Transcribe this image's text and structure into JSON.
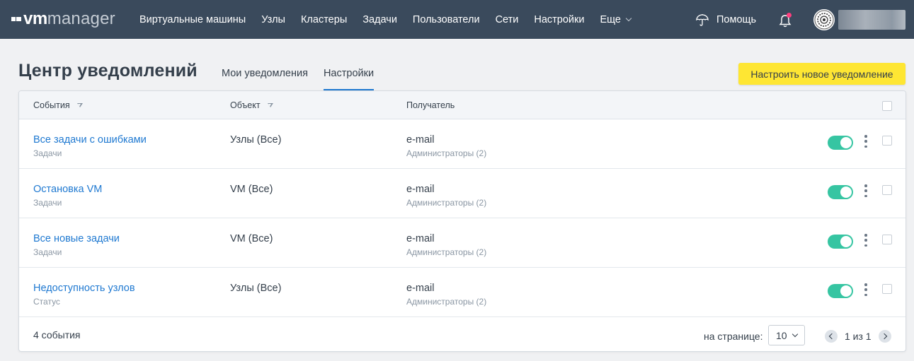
{
  "app": {
    "logo_vm": "vm",
    "logo_manager": "manager"
  },
  "nav": {
    "items": [
      {
        "label": "Виртуальные машины"
      },
      {
        "label": "Узлы"
      },
      {
        "label": "Кластеры"
      },
      {
        "label": "Задачи"
      },
      {
        "label": "Пользователи"
      },
      {
        "label": "Сети"
      },
      {
        "label": "Настройки"
      },
      {
        "label": "Еще"
      }
    ],
    "help_label": "Помощь",
    "notification_dot_color": "#ff3f7f"
  },
  "header": {
    "title": "Центр уведомлений",
    "tabs": [
      {
        "label": "Мои уведомления",
        "active": false
      },
      {
        "label": "Настройки",
        "active": true
      }
    ],
    "primary_button": "Настроить новое уведомление"
  },
  "table": {
    "columns": {
      "events": "События",
      "object": "Объект",
      "recipient": "Получатель"
    },
    "rows": [
      {
        "name": "Все задачи с ошибками",
        "category": "Задачи",
        "object": "Узлы (Все)",
        "recipient": "e-mail",
        "recipient_detail": "Администраторы (2)",
        "enabled": true
      },
      {
        "name": "Остановка VM",
        "category": "Задачи",
        "object": "VM (Все)",
        "recipient": "e-mail",
        "recipient_detail": "Администраторы (2)",
        "enabled": true
      },
      {
        "name": "Все новые задачи",
        "category": "Задачи",
        "object": "VM (Все)",
        "recipient": "e-mail",
        "recipient_detail": "Администраторы (2)",
        "enabled": true
      },
      {
        "name": "Недоступность узлов",
        "category": "Статус",
        "object": "Узлы (Все)",
        "recipient": "e-mail",
        "recipient_detail": "Администраторы (2)",
        "enabled": true
      }
    ]
  },
  "footer": {
    "count": "4 события",
    "per_page_label": "на странице:",
    "per_page_value": "10",
    "page_text": "1 из 1"
  },
  "colors": {
    "topbar": "#3a4a5c",
    "accent_link": "#1f79d1",
    "primary_button": "#fee633",
    "toggle_on": "#36c5a2"
  }
}
